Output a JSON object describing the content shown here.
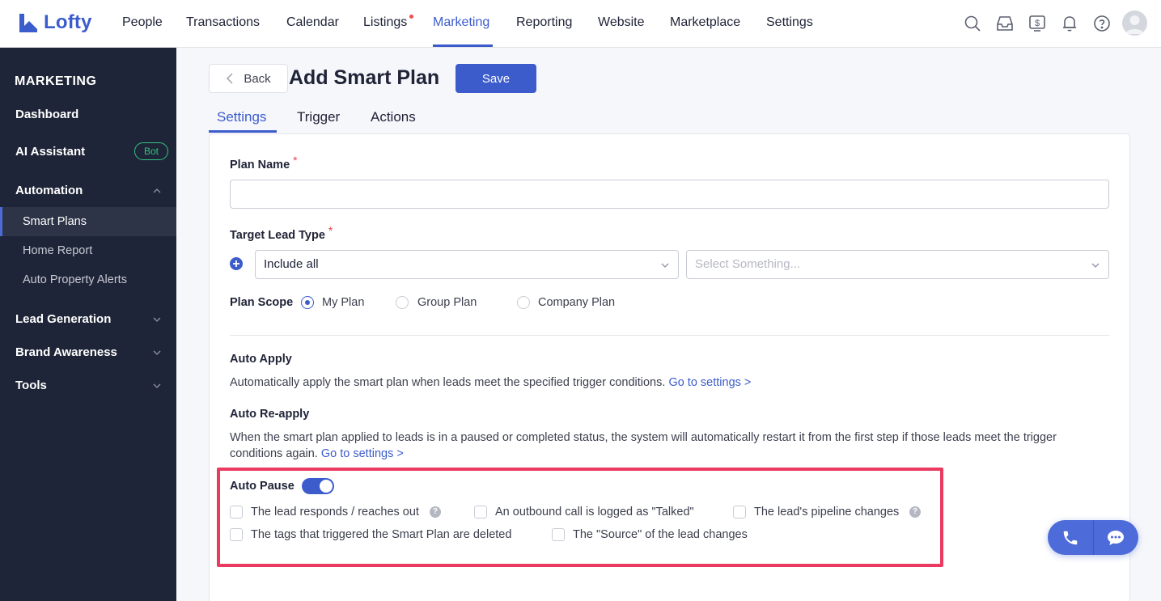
{
  "brand": {
    "name": "Lofty",
    "accent": "#3c5ccc"
  },
  "nav": {
    "items": [
      "People",
      "Transactions",
      "Calendar",
      "Listings",
      "Marketing",
      "Reporting",
      "Website",
      "Marketplace",
      "Settings"
    ],
    "active": "Marketing"
  },
  "sidebar": {
    "title": "MARKETING",
    "items": {
      "dashboard": "Dashboard",
      "ai_assistant": "AI Assistant",
      "ai_badge": "Bot",
      "automation": "Automation",
      "smart_plans": "Smart Plans",
      "home_report": "Home Report",
      "auto_property_alerts": "Auto Property Alerts",
      "lead_generation": "Lead Generation",
      "brand_awareness": "Brand Awareness",
      "tools": "Tools"
    }
  },
  "header": {
    "back": "Back",
    "title": "Add Smart Plan",
    "save": "Save"
  },
  "tabs": [
    "Settings",
    "Trigger",
    "Actions"
  ],
  "form": {
    "plan_name_label": "Plan Name",
    "plan_name_value": "",
    "required_mark": "*",
    "target_lead_type_label": "Target Lead Type",
    "lead_type_select": "Include all",
    "lead_value_placeholder": "Select Something...",
    "plan_scope_label": "Plan Scope",
    "scope_options": [
      "My Plan",
      "Group Plan",
      "Company Plan"
    ],
    "scope_selected": "My Plan",
    "auto_apply_title": "Auto Apply",
    "auto_apply_text": "Automatically apply the smart plan when leads meet the specified trigger conditions.",
    "auto_reapply_title": "Auto Re-apply",
    "auto_reapply_text": "When the smart plan applied to leads is in a paused or completed status, the system will automatically restart it from the first step if those leads meet the trigger conditions again.",
    "go_to_settings": "Go to settings >",
    "auto_pause_title": "Auto Pause",
    "auto_pause_on": true,
    "pause_conditions": [
      "The lead responds / reaches out",
      "An outbound call is logged as \"Talked\"",
      "The lead's pipeline changes",
      "The tags that triggered the Smart Plan are deleted",
      "The \"Source\" of the lead changes"
    ],
    "help_glyph": "?"
  }
}
